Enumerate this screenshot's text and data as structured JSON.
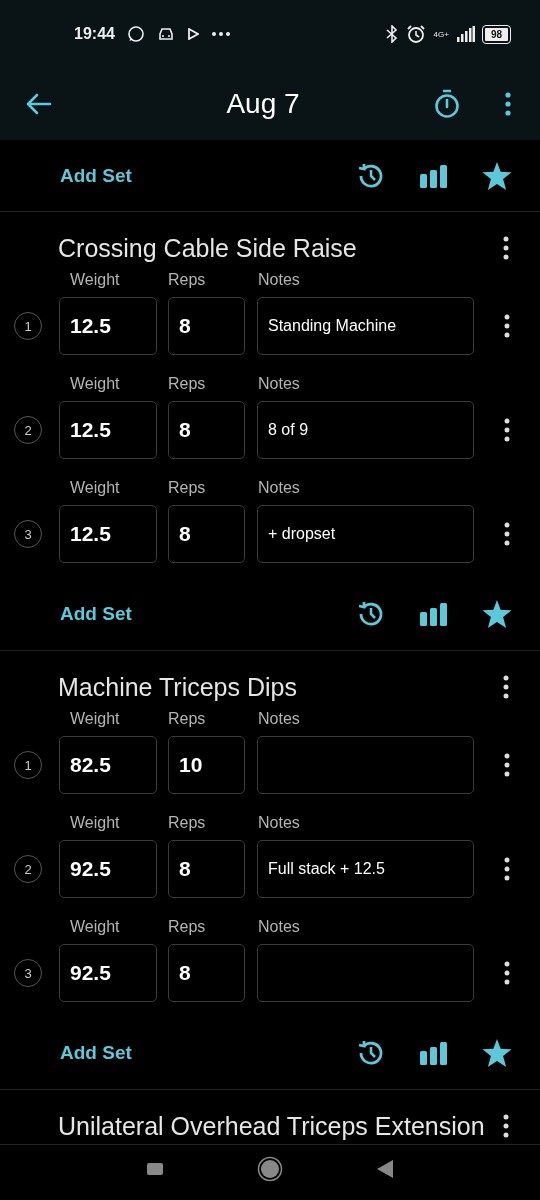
{
  "status_bar": {
    "time": "19:44",
    "network": "4G+",
    "battery": "98"
  },
  "app_bar": {
    "title": "Aug 7"
  },
  "exercises": [
    {
      "add_set": "Add Set"
    },
    {
      "name": "Crossing Cable Side Raise",
      "sets": [
        {
          "number": "1",
          "weight_label": "Weight",
          "reps_label": "Reps",
          "notes_label": "Notes",
          "weight": "12.5",
          "reps": "8",
          "notes": "Standing Machine"
        },
        {
          "number": "2",
          "weight_label": "Weight",
          "reps_label": "Reps",
          "notes_label": "Notes",
          "weight": "12.5",
          "reps": "8",
          "notes": "8 of 9"
        },
        {
          "number": "3",
          "weight_label": "Weight",
          "reps_label": "Reps",
          "notes_label": "Notes",
          "weight": "12.5",
          "reps": "8",
          "notes": "+ dropset"
        }
      ],
      "add_set": "Add Set"
    },
    {
      "name": "Machine Triceps Dips",
      "sets": [
        {
          "number": "1",
          "weight_label": "Weight",
          "reps_label": "Reps",
          "notes_label": "Notes",
          "weight": "82.5",
          "reps": "10"
        },
        {
          "number": "2",
          "weight_label": "Weight",
          "reps_label": "Reps",
          "notes_label": "Notes",
          "weight": "92.5",
          "reps": "8",
          "notes": "Full stack + 12.5"
        },
        {
          "number": "3",
          "weight_label": "Weight",
          "reps_label": "Reps",
          "notes_label": "Notes",
          "weight": "92.5",
          "reps": "8"
        }
      ],
      "add_set": "Add Set"
    },
    {
      "name": "Unilateral Overhead Triceps Extension"
    }
  ]
}
